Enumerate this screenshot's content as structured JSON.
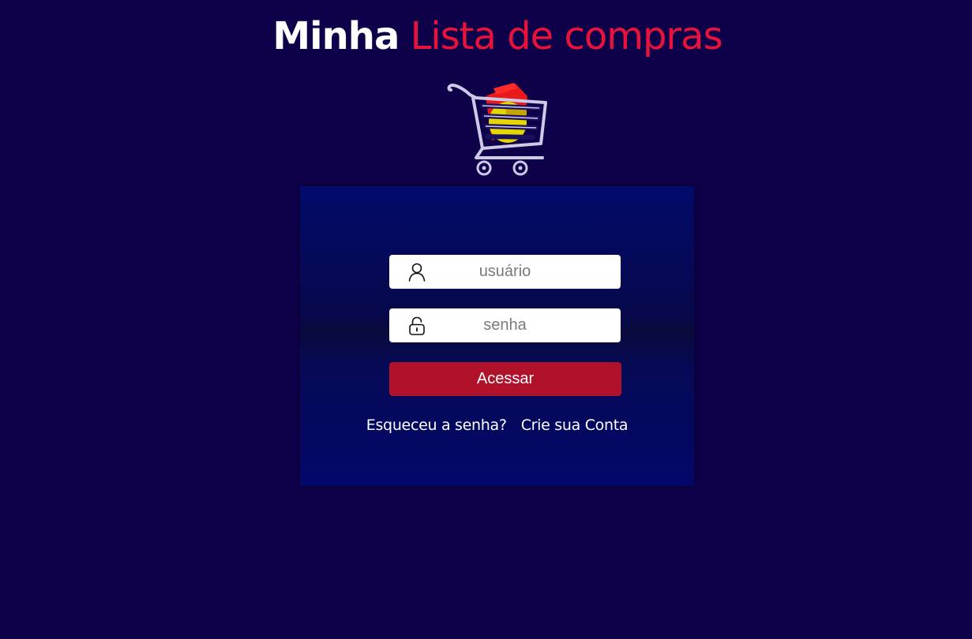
{
  "header": {
    "title_part1": "Minha",
    "title_part2": "Lista de compras"
  },
  "logo": {
    "icon": "shopping-cart-icon"
  },
  "login": {
    "username": {
      "icon": "user-icon",
      "placeholder": "usuário",
      "value": ""
    },
    "password": {
      "icon": "lock-icon",
      "placeholder": "senha",
      "value": ""
    },
    "submit_label": "Acessar",
    "forgot_link": "Esqueceu a senha?",
    "signup_link": "Crie sua Conta"
  },
  "colors": {
    "background": "#0f004a",
    "accent_red": "#e8123a",
    "button_red": "#b0122c",
    "card_blue": "#020b6b"
  }
}
